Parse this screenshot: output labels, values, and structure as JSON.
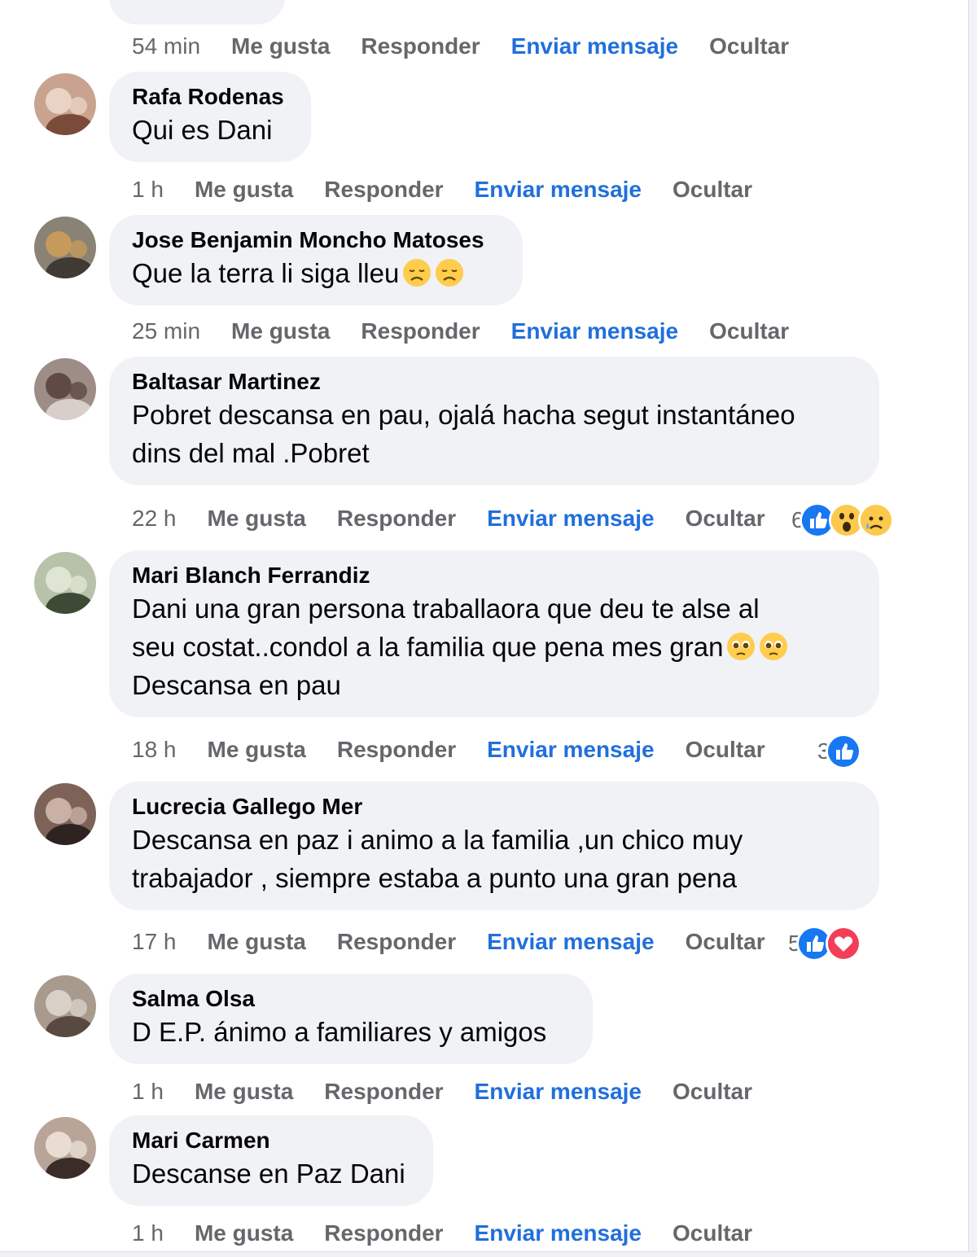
{
  "top_comment": {
    "actions": {
      "time": "54 min",
      "like": "Me gusta",
      "reply": "Responder",
      "message": "Enviar mensaje",
      "hide": "Ocultar"
    }
  },
  "comments": [
    {
      "author": "Rafa Rodenas",
      "lines": [
        "Qui es Dani"
      ],
      "emojis": [],
      "actions": {
        "time": "1 h",
        "like": "Me gusta",
        "reply": "Responder",
        "message": "Enviar mensaje",
        "hide": "Ocultar"
      },
      "reactions": null
    },
    {
      "author": "Jose Benjamin Moncho Matoses",
      "lines": [
        "Que la terra li siga lleu"
      ],
      "emojis": [
        "disappointed-face-emoji",
        "disappointed-face-emoji"
      ],
      "actions": {
        "time": "25 min",
        "like": "Me gusta",
        "reply": "Responder",
        "message": "Enviar mensaje",
        "hide": "Ocultar"
      },
      "reactions": null
    },
    {
      "author": "Baltasar Martinez",
      "lines": [
        "Pobret descansa en pau, ojalá hacha segut instantáneo",
        "dins del mal .Pobret"
      ],
      "emojis": [],
      "actions": {
        "time": "22 h",
        "like": "Me gusta",
        "reply": "Responder",
        "message": "Enviar mensaje",
        "hide": "Ocultar"
      },
      "reactions": {
        "count": "6",
        "icons": [
          "like-reaction-icon",
          "wow-reaction-icon",
          "sad-reaction-icon"
        ]
      }
    },
    {
      "author": "Mari Blanch Ferrandiz",
      "lines": [
        "Dani una gran persona traballaora que deu te alse al",
        "seu costat..condol a la familia que pena mes gran",
        "Descansa en pau"
      ],
      "emojis": [
        "pleading-face-emoji",
        "pleading-face-emoji"
      ],
      "actions": {
        "time": "18 h",
        "like": "Me gusta",
        "reply": "Responder",
        "message": "Enviar mensaje",
        "hide": "Ocultar"
      },
      "reactions": {
        "count": "3",
        "icons": [
          "like-reaction-icon"
        ]
      }
    },
    {
      "author": "Lucrecia Gallego Mer",
      "lines": [
        "Descansa en paz i animo a la familia ,un chico muy",
        "trabajador , siempre estaba a punto una gran pena"
      ],
      "emojis": [],
      "actions": {
        "time": "17 h",
        "like": "Me gusta",
        "reply": "Responder",
        "message": "Enviar mensaje",
        "hide": "Ocultar"
      },
      "reactions": {
        "count": "5",
        "icons": [
          "like-reaction-icon",
          "love-reaction-icon"
        ]
      }
    },
    {
      "author": "Salma Olsa",
      "lines": [
        "D E.P. ánimo a familiares y amigos"
      ],
      "emojis": [],
      "actions": {
        "time": "1 h",
        "like": "Me gusta",
        "reply": "Responder",
        "message": "Enviar mensaje",
        "hide": "Ocultar"
      },
      "reactions": null
    },
    {
      "author": "Mari Carmen",
      "lines": [
        "Descanse en Paz Dani"
      ],
      "emojis": [],
      "actions": {
        "time": "1 h",
        "like": "Me gusta",
        "reply": "Responder",
        "message": "Enviar mensaje",
        "hide": "Ocultar"
      },
      "reactions": null
    }
  ],
  "colors": {
    "bubble": "#f0f2f5",
    "link": "#216fdb",
    "muted": "#65676b",
    "like": "#1877f2",
    "love": "#f33e58"
  }
}
